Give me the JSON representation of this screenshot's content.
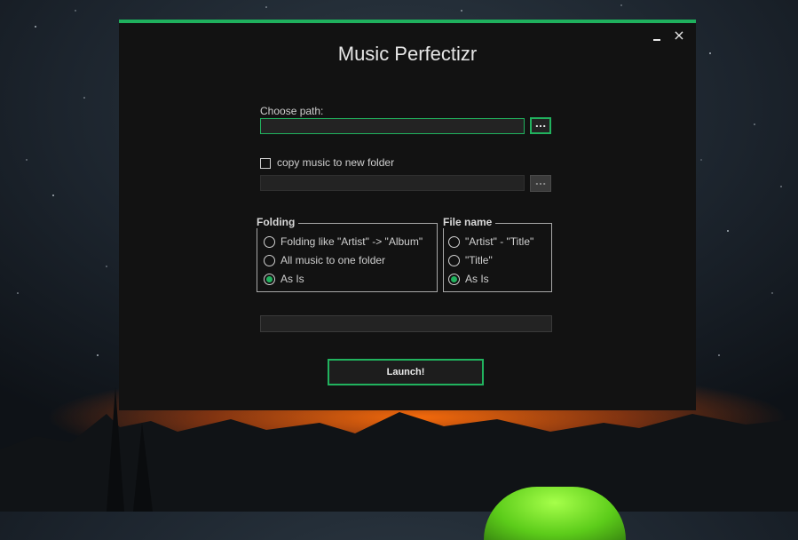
{
  "window": {
    "title": "Music Perfectizr",
    "min_label": "",
    "close_label": "×"
  },
  "path": {
    "label": "Choose path:",
    "value": "",
    "browse_label": "..."
  },
  "copy": {
    "label": "copy music to new folder",
    "checked": false,
    "value": "",
    "browse_label": "..."
  },
  "folding": {
    "title": "Folding",
    "options": [
      {
        "label": "Folding like \"Artist\" -> \"Album\"",
        "checked": false
      },
      {
        "label": "All music to one folder",
        "checked": false
      },
      {
        "label": "As Is",
        "checked": true
      }
    ]
  },
  "filename": {
    "title": "File name",
    "options": [
      {
        "label": "\"Artist\" - \"Title\"",
        "checked": false
      },
      {
        "label": "\"Title\"",
        "checked": false
      },
      {
        "label": "As Is",
        "checked": true
      }
    ]
  },
  "progress": {
    "value": 0
  },
  "launch_label": "Launch!",
  "colors": {
    "accent": "#21b25e",
    "window_bg": "#121212",
    "field_bg": "#232323"
  }
}
